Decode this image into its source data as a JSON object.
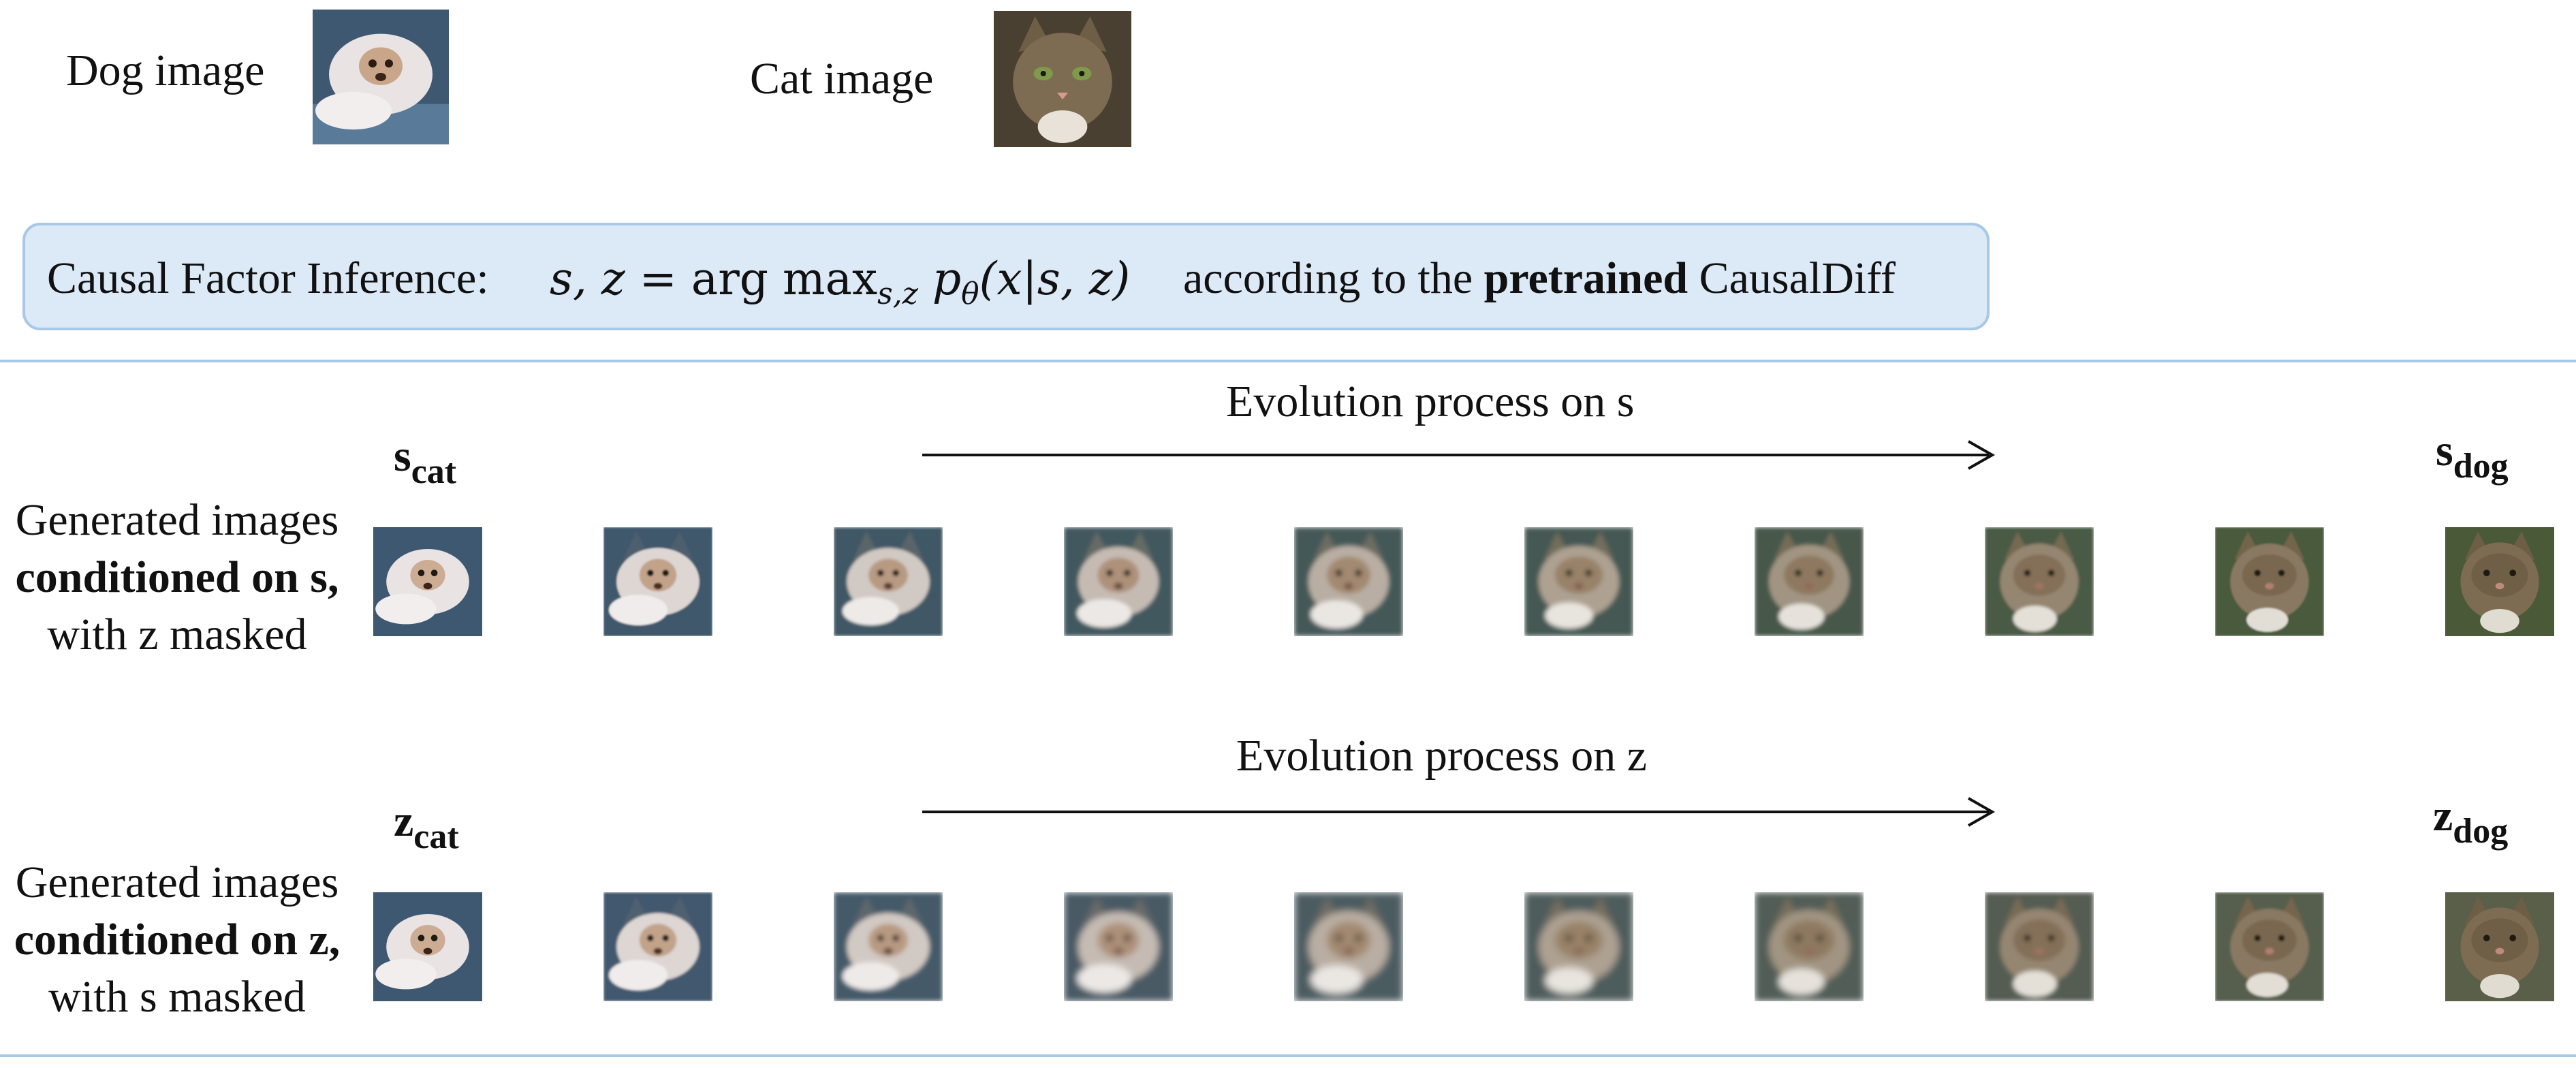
{
  "inputs": {
    "dog_label": "Dog image",
    "cat_label": "Cat image"
  },
  "inference_box": {
    "prefix": "Causal Factor Inference:",
    "formula_lhs": "s, z",
    "formula_eq": "=",
    "formula_arg": "arg max",
    "formula_sub": "s,z",
    "formula_rhs_p": "p",
    "formula_rhs_theta": "θ",
    "formula_rhs_args": "(x|s, z)",
    "suffix_1": "according to the",
    "suffix_bold": "pretrained",
    "suffix_2": "CausalDiff"
  },
  "row_s": {
    "title": "Evolution process on s",
    "start_symbol": "s",
    "start_sub": "cat",
    "end_symbol": "s",
    "end_sub": "dog",
    "label_line1": "Generated images",
    "label_line2_bold": "conditioned on s",
    "label_line2_rest": ",",
    "label_line3": "with z masked",
    "frames": 10
  },
  "row_z": {
    "title": "Evolution process on z",
    "start_symbol": "z",
    "start_sub": "cat",
    "end_symbol": "z",
    "end_sub": "dog",
    "label_line1": "Generated images",
    "label_line2_bold": "conditioned on z",
    "label_line2_rest": ",",
    "label_line3": "with s masked",
    "frames": 10
  },
  "colors": {
    "box_fill": "#dce9f6",
    "box_border": "#a9c8e6",
    "divider": "#a9c8e6"
  }
}
